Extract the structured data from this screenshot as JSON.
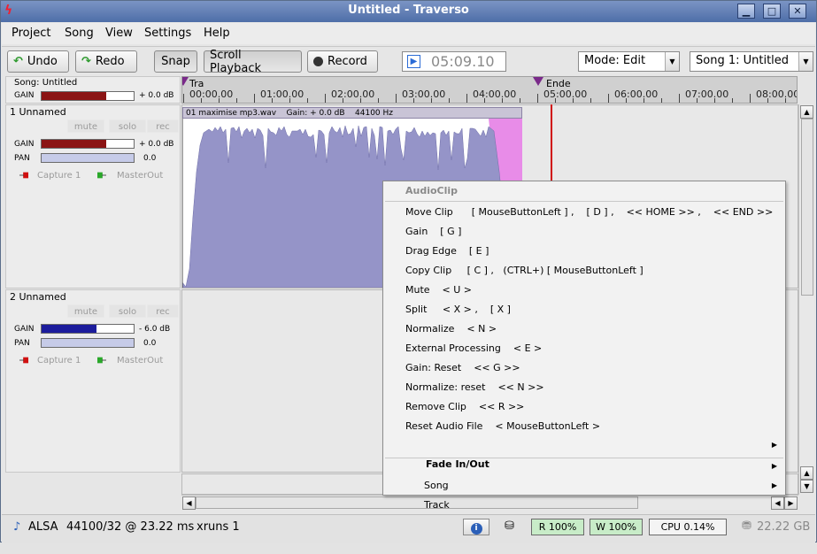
{
  "window": {
    "title": "Untitled - Traverso",
    "minimize": "▁",
    "maximize": "□",
    "close": "✕"
  },
  "menu": [
    {
      "label": "Project"
    },
    {
      "label": "Song"
    },
    {
      "label": "View"
    },
    {
      "label": "Settings"
    },
    {
      "label": "Help"
    }
  ],
  "toolbar": {
    "undo": "Undo",
    "redo": "Redo",
    "snap": "Snap",
    "scroll_playback": "Scroll Playback",
    "record": "Record",
    "time": "05:09.10",
    "mode": "Mode: Edit",
    "song_select": "Song 1: Untitled"
  },
  "song_header": {
    "label": "Song: Untitled",
    "gain_label": "GAIN",
    "gain_value": "+ 0.0 dB",
    "gain_level": 0.7
  },
  "ruler": {
    "ticks": [
      "00:00.00",
      "01:00.00",
      "02:00.00",
      "03:00.00",
      "04:00.00",
      "05:00.00",
      "06:00.00",
      "07:00.00",
      "08:00.00"
    ],
    "start_marker": "Tra",
    "end_marker": "Ende"
  },
  "tracks": [
    {
      "num_name": "1  Unnamed",
      "mute": "mute",
      "solo": "solo",
      "rec": "rec",
      "gain_label": "GAIN",
      "gain_value": "+ 0.0 dB",
      "gain_level": 0.7,
      "gain_color": "#8b1414",
      "pan_label": "PAN",
      "pan_value": "0.0",
      "capture": "Capture 1",
      "master": "MasterOut"
    },
    {
      "num_name": "2  Unnamed",
      "mute": "mute",
      "solo": "solo",
      "rec": "rec",
      "gain_label": "GAIN",
      "gain_value": "- 6.0 dB",
      "gain_level": 0.6,
      "gain_color": "#1c1c9c",
      "pan_label": "PAN",
      "pan_value": "0.0",
      "capture": "Capture 1",
      "master": "MasterOut"
    }
  ],
  "clip": {
    "name": "01 maximise mp3.wav",
    "gain": "Gain: + 0.0 dB",
    "rate": "44100 Hz"
  },
  "context_menu": {
    "title": "AudioClip",
    "items": [
      {
        "label": "Move Clip      [ MouseButtonLeft ] ,    [ D ] ,    << HOME >> ,    << END >>"
      },
      {
        "label": "Gain    [ G ]"
      },
      {
        "label": "Drag Edge    [ E ]"
      },
      {
        "label": "Copy Clip     [ C ] ,   (CTRL+) [ MouseButtonLeft ]"
      },
      {
        "label": "Mute    < U >"
      },
      {
        "label": "Split     < X > ,    [ X ]"
      },
      {
        "label": "Normalize    < N >"
      },
      {
        "label": "External Processing    < E >"
      },
      {
        "label": "Gain: Reset    << G >>"
      },
      {
        "label": "Normalize: reset    << N >>"
      },
      {
        "label": "Remove Clip    << R >>"
      },
      {
        "label": "Reset Audio File    < MouseButtonLeft >"
      }
    ],
    "fade": "Fade In/Out",
    "song": "Song",
    "track": "Track"
  },
  "status": {
    "driver": "ALSA",
    "rate": "44100/32 @ 23.22 ms",
    "xruns": "xruns 1",
    "read": "R 100%",
    "write": "W 100%",
    "cpu": "CPU 0.14%",
    "disk": "22.22 GB"
  },
  "colors": {
    "clip_wave": "#9594c8",
    "fade": "#e88ce8",
    "playhead": "#d01010",
    "accent": "#2b6bd6"
  }
}
